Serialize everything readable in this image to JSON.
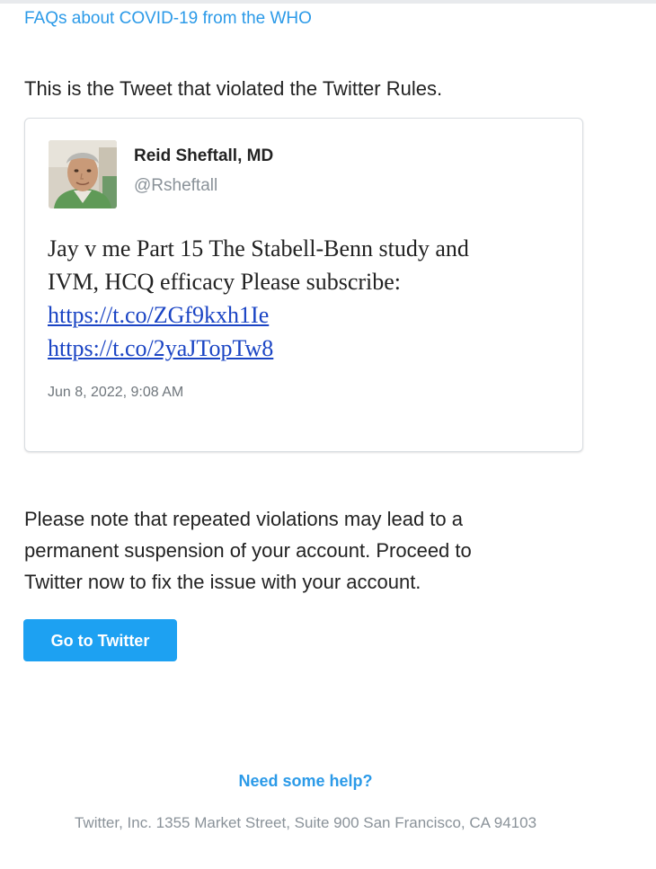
{
  "header": {
    "faq_link": "FAQs about COVID-19 from the WHO"
  },
  "intro": {
    "text": "This is the Tweet that violated the Twitter Rules."
  },
  "tweet": {
    "author_name": "Reid Sheftall, MD",
    "author_handle": "@Rsheftall",
    "body_lines": [
      "Jay v me Part 15 The Stabell-Benn study and",
      "IVM, HCQ efficacy Please subscribe:"
    ],
    "links": [
      "https://t.co/ZGf9kxh1Ie",
      "https://t.co/2yaJTopTw8"
    ],
    "timestamp": "Jun 8, 2022, 9:08 AM",
    "avatar_icon": "profile-photo"
  },
  "warning": {
    "lines": [
      "Please note that repeated violations may lead to a",
      "permanent suspension of your account. Proceed to",
      "Twitter now to fix the issue with your account."
    ]
  },
  "cta": {
    "label": "Go to Twitter"
  },
  "footer": {
    "help_link": "Need some help?",
    "address": "Twitter, Inc. 1355 Market Street, Suite 900 San Francisco, CA 94103"
  },
  "colors": {
    "link_blue": "#2b9ae8",
    "button_blue": "#1da1f2",
    "tweet_link": "#1a44c4",
    "muted_gray": "#8a9299"
  }
}
